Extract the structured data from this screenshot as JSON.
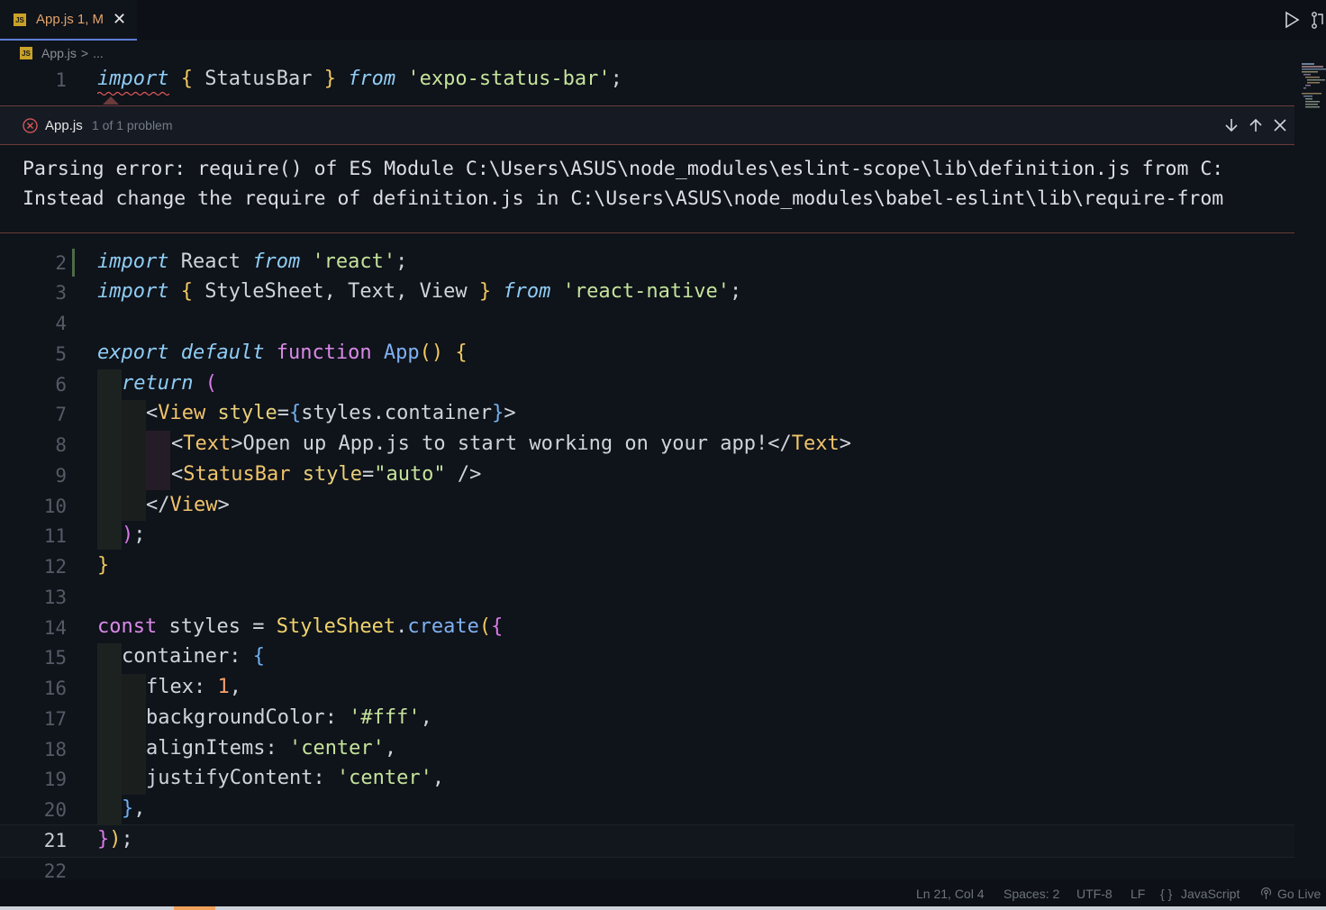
{
  "tab": {
    "label": "App.js 1, M",
    "icon": "js-file-icon",
    "close": "✕"
  },
  "breadcrumb": {
    "file": "App.js",
    "sep": ">",
    "more": "..."
  },
  "problem": {
    "file": "App.js",
    "count": "1 of 1 problem",
    "lines": [
      "Parsing error: require() of ES Module C:\\Users\\ASUS\\node_modules\\eslint-scope\\lib\\definition.js from C:",
      "Instead change the require of definition.js in C:\\Users\\ASUS\\node_modules\\babel-eslint\\lib\\require-from"
    ]
  },
  "line_numbers": [
    "1",
    "2",
    "3",
    "4",
    "5",
    "6",
    "7",
    "8",
    "9",
    "10",
    "11",
    "12",
    "13",
    "14",
    "15",
    "16",
    "17",
    "18",
    "19",
    "20",
    "21",
    "22"
  ],
  "code": {
    "l1": {
      "import": "import",
      "open": "{",
      "id": " StatusBar ",
      "close": "}",
      "from": "from",
      "str": "'expo-status-bar'",
      "end": ";"
    },
    "l2": {
      "import": "import",
      "id": " React ",
      "from": "from",
      "str": "'react'",
      "end": ";"
    },
    "l3": {
      "import": "import",
      "open": "{",
      "id": " StyleSheet, Text, View ",
      "close": "}",
      "from": "from",
      "str": "'react-native'",
      "end": ";"
    },
    "l5": {
      "export": "export",
      "default": "default",
      "function": "function",
      "name": "App",
      "parens": "()",
      "open": "{"
    },
    "l6": {
      "return": "return",
      "paren": "("
    },
    "l7": {
      "lt": "<",
      "tag": "View",
      "attr": "style",
      "eq": "=",
      "ob": "{",
      "val": "styles.container",
      "cb": "}",
      "gt": ">"
    },
    "l8": {
      "lt": "<",
      "tag": "Text",
      "gt": ">",
      "text": "Open up App.js to start working on your app!",
      "clt": "</",
      "ctag": "Text",
      "cgt": ">"
    },
    "l9": {
      "lt": "<",
      "tag": "StatusBar",
      "attr": "style",
      "eq": "=",
      "str": "\"auto\"",
      "end": " />"
    },
    "l10": {
      "lt": "</",
      "tag": "View",
      "gt": ">"
    },
    "l11": {
      "paren": ")",
      "end": ";"
    },
    "l12": {
      "close": "}"
    },
    "l14": {
      "const": "const",
      "name": " styles ",
      "eq": "= ",
      "cls": "StyleSheet",
      "dot": ".",
      "call": "create",
      "paren": "(",
      "open": "{"
    },
    "l15": {
      "key": "container",
      "colon": ": ",
      "open": "{"
    },
    "l16": {
      "key": "flex",
      "colon": ": ",
      "num": "1",
      "comma": ","
    },
    "l17": {
      "key": "backgroundColor",
      "colon": ": ",
      "str": "'#fff'",
      "comma": ","
    },
    "l18": {
      "key": "alignItems",
      "colon": ": ",
      "str": "'center'",
      "comma": ","
    },
    "l19": {
      "key": "justifyContent",
      "colon": ": ",
      "str": "'center'",
      "comma": ","
    },
    "l20": {
      "close": "}",
      "comma": ","
    },
    "l21": {
      "close": "}",
      "paren": ")",
      "end": ";"
    }
  },
  "status": {
    "position": "Ln 21, Col 4",
    "spaces": "Spaces: 2",
    "encoding": "UTF-8",
    "eol": "LF",
    "braces": "{ }",
    "language": "JavaScript",
    "golive": "Go Live"
  },
  "colors": {
    "accent": "#5e7dd6",
    "error": "#e05a5a",
    "modified": "#e3a36a"
  }
}
